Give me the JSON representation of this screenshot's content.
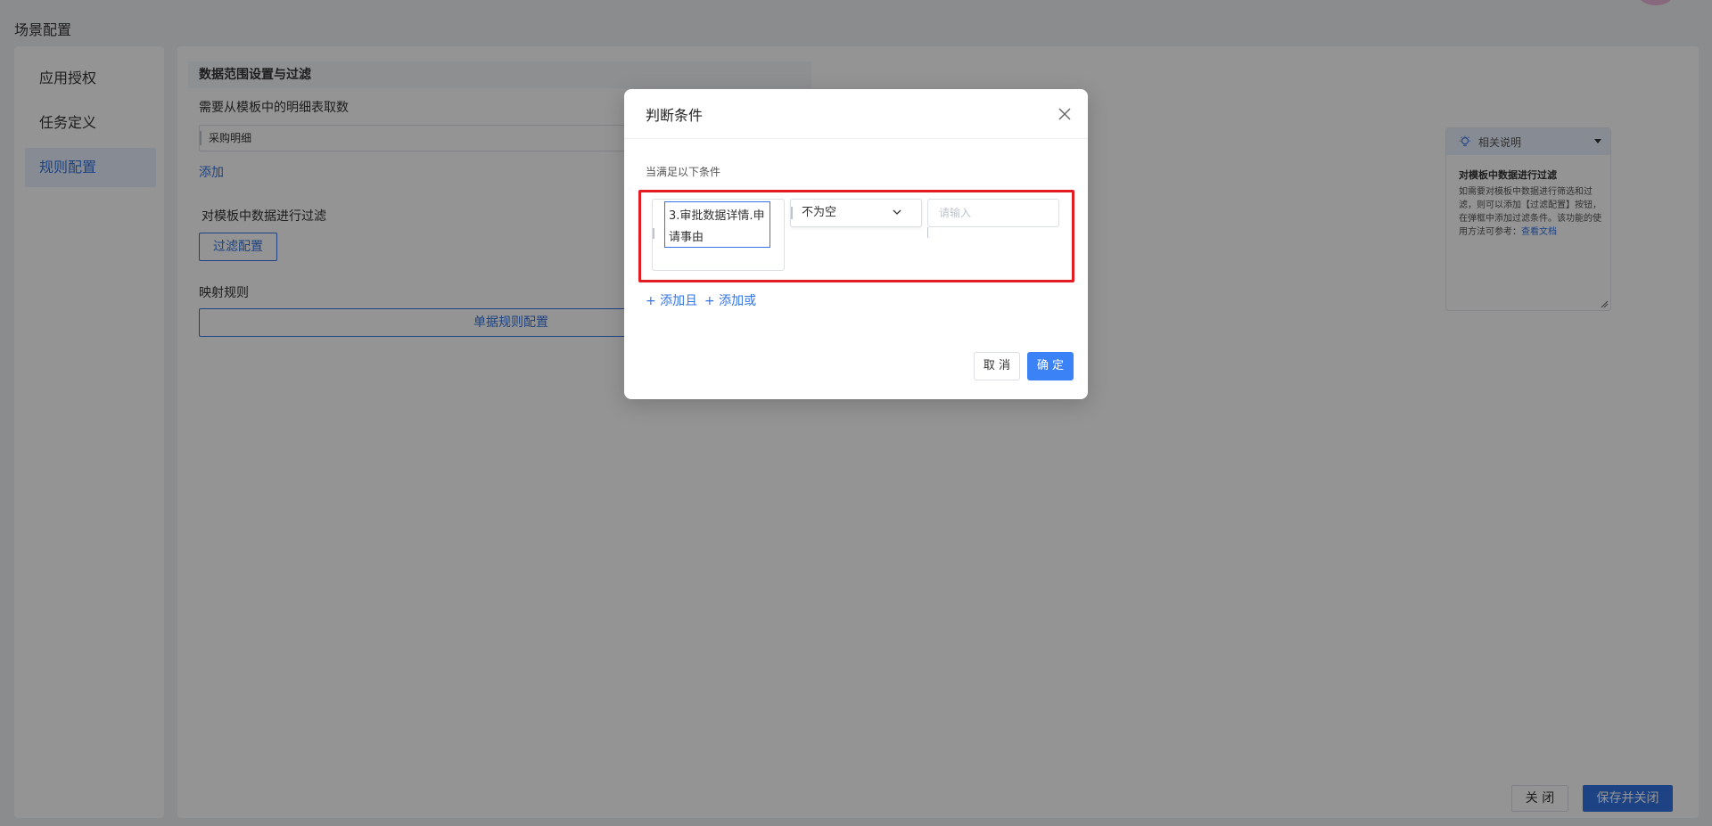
{
  "page": {
    "title": "场景配置"
  },
  "left_nav": {
    "items": [
      {
        "label": "应用授权",
        "active": false
      },
      {
        "label": "任务定义",
        "active": false
      },
      {
        "label": "规则配置",
        "active": true
      }
    ]
  },
  "content": {
    "section_title": "数据范围设置与过滤",
    "detail_table_label": "需要从模板中的明细表取数",
    "detail_table_value": "采购明细",
    "add_link": "添加",
    "filter_label": "对模板中数据进行过滤",
    "filter_button": "过滤配置",
    "mapping_label": "映射规则",
    "mapping_button": "单据规则配置"
  },
  "help_panel": {
    "header": "相关说明",
    "title": "对模板中数据进行过滤",
    "body": "如需要对模板中数据进行筛选和过滤，则可以添加【过滤配置】按钮，在弹框中添加过滤条件。该功能的使用方法可参考：",
    "doc_link": "查看文档"
  },
  "footer": {
    "close_button": "关 闭",
    "save_close_button": "保存并关闭"
  },
  "modal": {
    "title": "判断条件",
    "hint": "当满足以下条件",
    "condition": {
      "field_chip": "3.审批数据详情.申请事由",
      "operator": "不为空",
      "value_placeholder": "请输入"
    },
    "add_and": "+ 添加且",
    "add_or": "+ 添加或",
    "cancel": "取 消",
    "ok": "确 定"
  },
  "colors": {
    "primary": "#3574e4",
    "highlight_box": "#e31b23",
    "mask": "rgba(0,0,0,0.42)"
  }
}
